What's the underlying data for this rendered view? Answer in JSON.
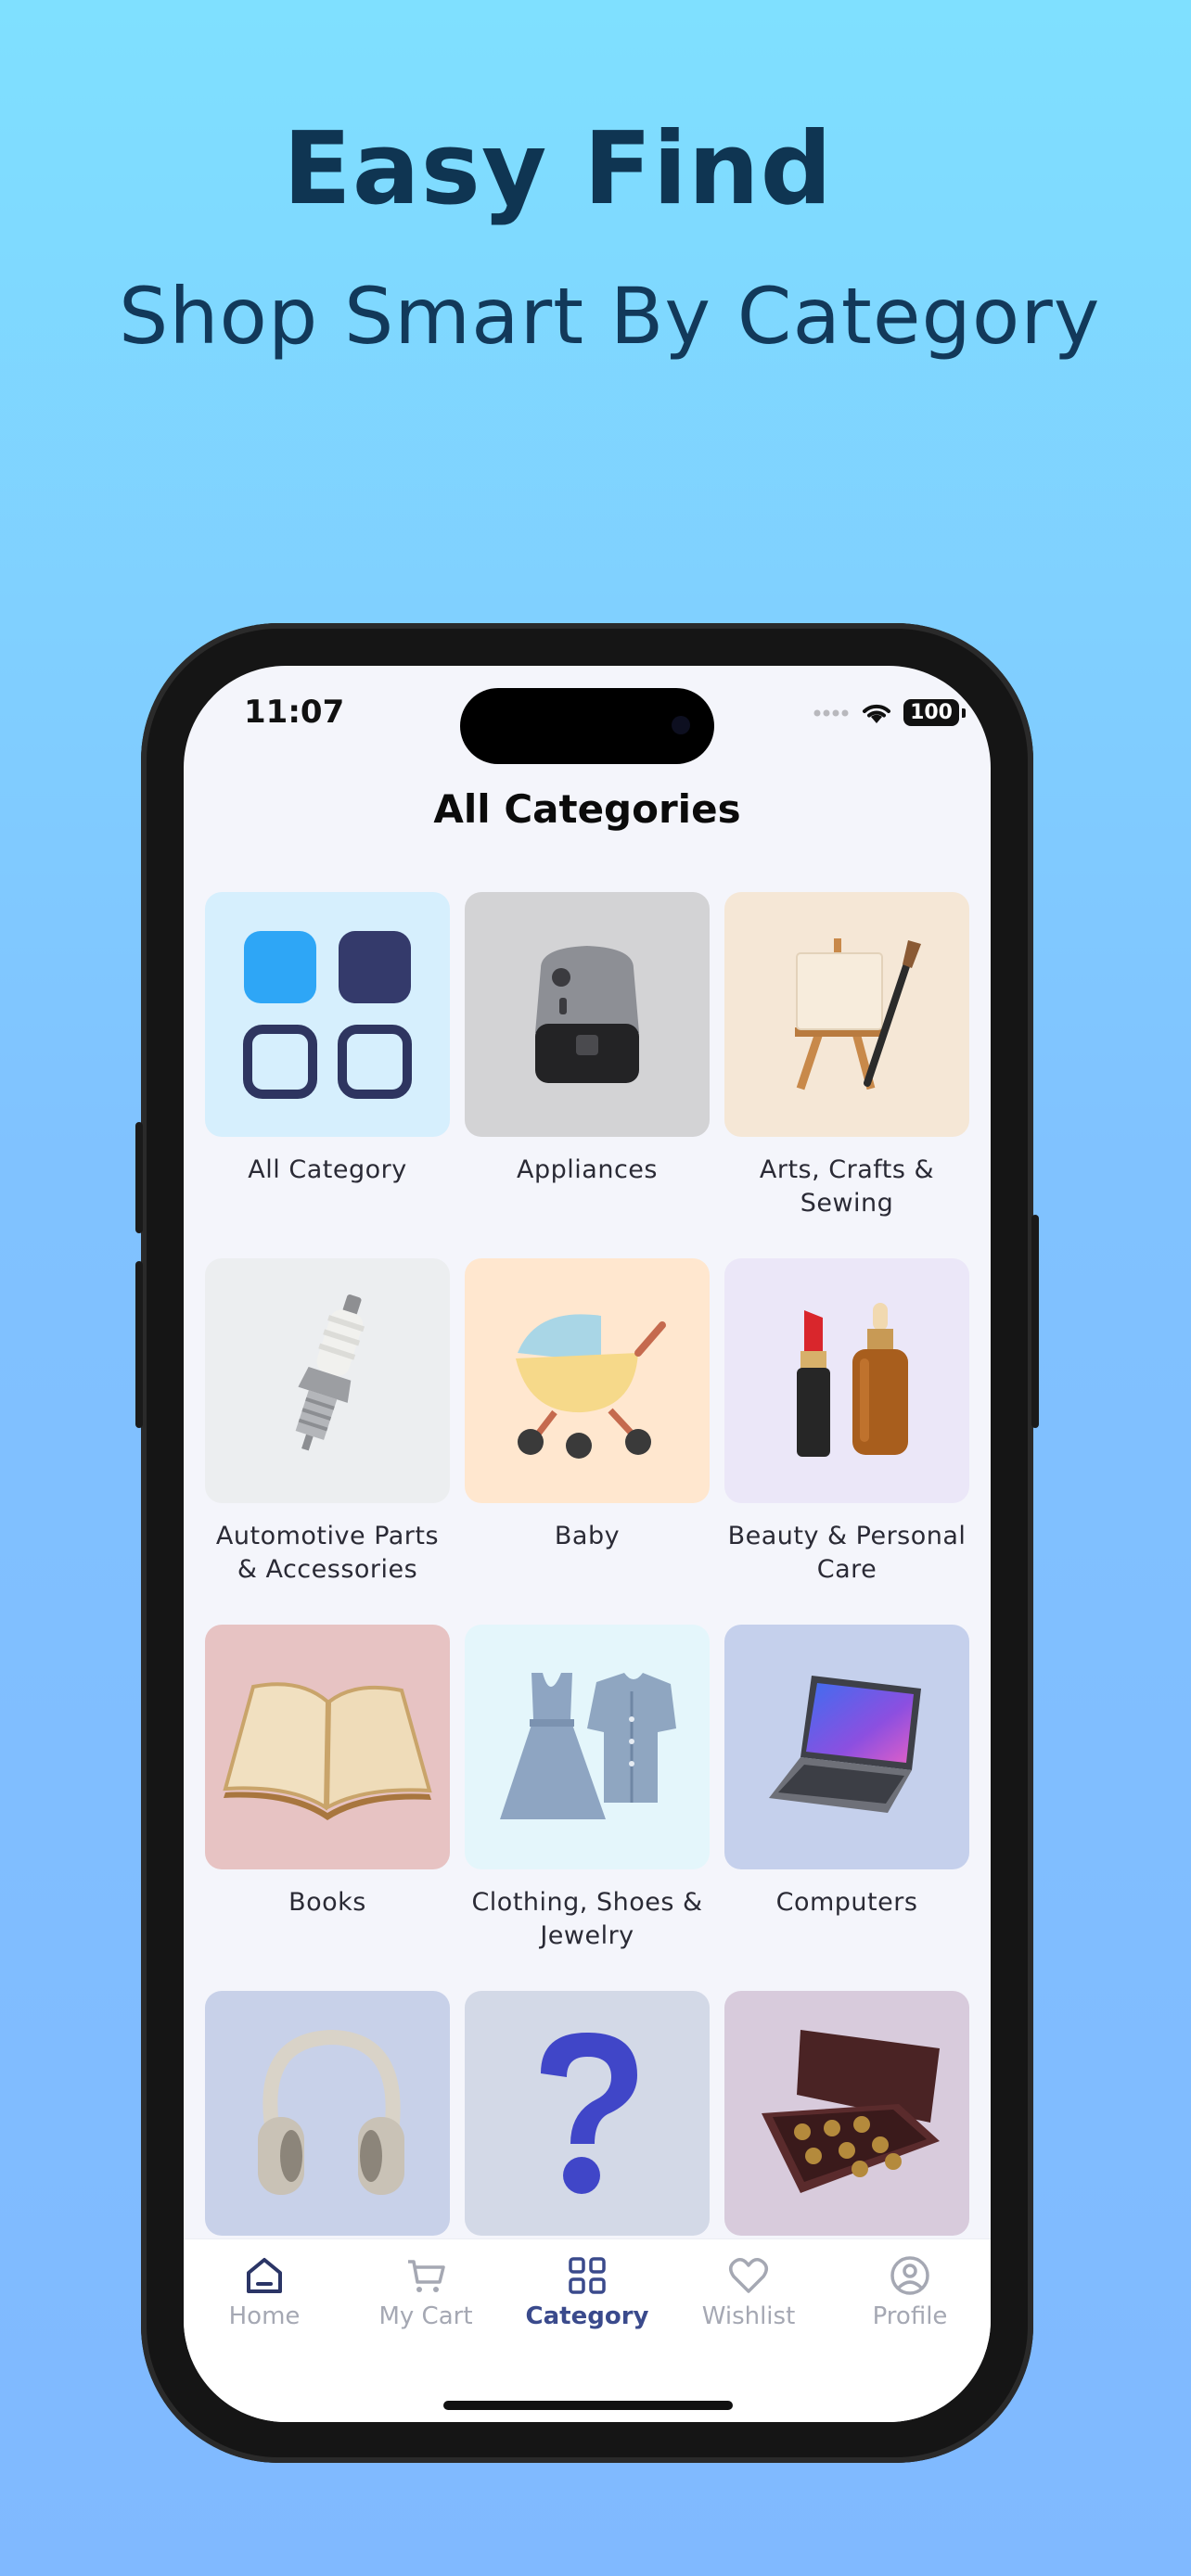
{
  "hero": {
    "headline": "Easy Find",
    "subline": "Shop Smart By Category"
  },
  "status_bar": {
    "time": "11:07",
    "battery": "100"
  },
  "page": {
    "title": "All Categories"
  },
  "categories": [
    {
      "label": "All Category",
      "icon": "grid-icon",
      "bg": "#d6effd"
    },
    {
      "label": "Appliances",
      "icon": "air-fryer-icon",
      "bg": "#d3d3d5"
    },
    {
      "label": "Arts, Crafts & Sewing",
      "icon": "easel-icon",
      "bg": "#f5e7d6"
    },
    {
      "label": "Automotive Parts & Accessories",
      "icon": "spark-plug-icon",
      "bg": "#eceef0"
    },
    {
      "label": "Baby",
      "icon": "stroller-icon",
      "bg": "#ffe7cf"
    },
    {
      "label": "Beauty & Personal Care",
      "icon": "cosmetics-icon",
      "bg": "#ebe7f8"
    },
    {
      "label": "Books",
      "icon": "book-icon",
      "bg": "#e7c3c3"
    },
    {
      "label": "Clothing, Shoes & Jewelry",
      "icon": "clothes-icon",
      "bg": "#e4f6fb"
    },
    {
      "label": "Computers",
      "icon": "laptop-icon",
      "bg": "#c5d0ec"
    },
    {
      "label": "",
      "icon": "headphones-icon",
      "bg": "#c8d1e9"
    },
    {
      "label": "",
      "icon": "question-mark-icon",
      "bg": "#d3d9e7"
    },
    {
      "label": "",
      "icon": "chocolate-box-icon",
      "bg": "#d8cbdc"
    }
  ],
  "tabbar": {
    "tabs": [
      {
        "label": "Home",
        "icon": "home-icon",
        "active": false
      },
      {
        "label": "My Cart",
        "icon": "cart-icon",
        "active": false
      },
      {
        "label": "Category",
        "icon": "category-grid-icon",
        "active": true
      },
      {
        "label": "Wishlist",
        "icon": "heart-icon",
        "active": false
      },
      {
        "label": "Profile",
        "icon": "profile-icon",
        "active": false
      }
    ],
    "active_color": "#3a4a8c",
    "inactive_color": "#a5a8b3"
  }
}
